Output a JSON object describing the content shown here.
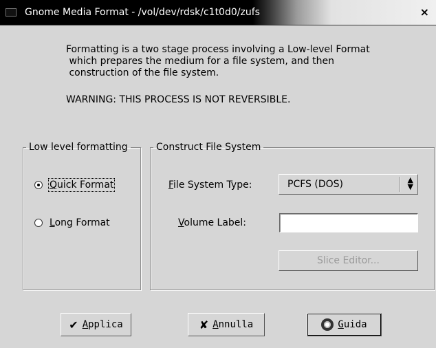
{
  "window": {
    "title": "Gnome Media Format - /vol/dev/rdsk/c1t0d0/zufs",
    "close_glyph": "×"
  },
  "intro": {
    "lines": [
      "Formatting is a two stage process involving a Low-level Format",
      " which prepares the medium for a file system, and then",
      " construction of the file system."
    ],
    "warning": "WARNING:  THIS PROCESS IS NOT REVERSIBLE."
  },
  "low_level": {
    "legend": "Low level formatting",
    "options": [
      {
        "label_mnemonic": "Q",
        "label_rest": "uick Format",
        "checked": true
      },
      {
        "label_mnemonic": "L",
        "label_rest": "ong Format",
        "checked": false
      }
    ]
  },
  "construct": {
    "legend": "Construct File System",
    "fs_type_label_mnemonic": "F",
    "fs_type_label_rest": "ile System Type:",
    "fs_type_value": "PCFS (DOS)",
    "volume_label_mnemonic": "V",
    "volume_label_rest": "olume Label:",
    "volume_value": "",
    "slice_editor": "Slice Editor..."
  },
  "buttons": {
    "apply_mnemonic": "A",
    "apply_rest": "pplica",
    "cancel_mnemonic": "A",
    "cancel_rest": "nnulla",
    "help_mnemonic": "G",
    "help_rest": "uida"
  },
  "icons": {
    "apply": "checkmark-icon",
    "cancel": "x-icon",
    "help": "lifebuoy-icon",
    "spinner": "updown-arrows-icon"
  }
}
